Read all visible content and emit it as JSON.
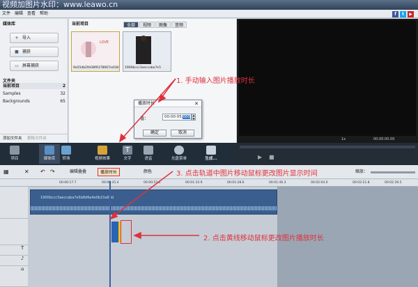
{
  "watermark": "视频加图片水印：www.leawo.cn",
  "menu": [
    "文件",
    "编辑",
    "查看",
    "帮助"
  ],
  "social": [
    "f",
    "t",
    "▶"
  ],
  "left": {
    "media_title": "媒体库",
    "buttons": [
      "导入",
      "捕获",
      "屏幕捕获"
    ],
    "folders_title": "文件夹",
    "folders": [
      {
        "name": "当前项目",
        "count": "2"
      },
      {
        "name": "Samples",
        "count": "32"
      },
      {
        "name": "Backgrounds",
        "count": "65"
      }
    ],
    "add_folder": "添加文件夹",
    "delete_folder": "删除文件夹"
  },
  "media": {
    "title": "当前项目",
    "tabs": [
      "全部",
      "视频",
      "图像",
      "音频"
    ],
    "thumbs": [
      {
        "caption": "9a55db29d38f6178667ed16/"
      },
      {
        "caption": "1900bccc3aeccaba7e5"
      }
    ]
  },
  "dialog": {
    "title": "播放时长",
    "label": "值：",
    "value_prefix": "00:00:05.",
    "value_sel": "000",
    "ok": "确定",
    "cancel": "取消"
  },
  "annotations": {
    "a1": "1. 手动输入图片播放时长",
    "a2": "2. 点击黄线移动鼠标更改图片播放时长",
    "a3": "3. 点击轨道中图片移动鼠标更改图片显示时间"
  },
  "toolbar": [
    "项目",
    "媒体库",
    "转场",
    "视频效果",
    "文字",
    "语音",
    "光盘菜单",
    "生成..."
  ],
  "transport": {
    "speed": "1x",
    "time": "00:00:00.00"
  },
  "track_header": {
    "split": "编辑叠叠",
    "duration": "播放时长",
    "color": "颜色",
    "zoom": "缩放："
  },
  "ruler": [
    "00:00:17.7",
    "00:00:35.4",
    "00:00:53.1",
    "00:01:10.9",
    "00:01:28.6",
    "00:01:46.3",
    "00:02:04.0",
    "00:02:21.8",
    "00:02:39.5",
    "00:02:57.2"
  ],
  "clip": {
    "caption": "1900bccc3aeccaba7e5b8d6a4e0b23a88d"
  }
}
